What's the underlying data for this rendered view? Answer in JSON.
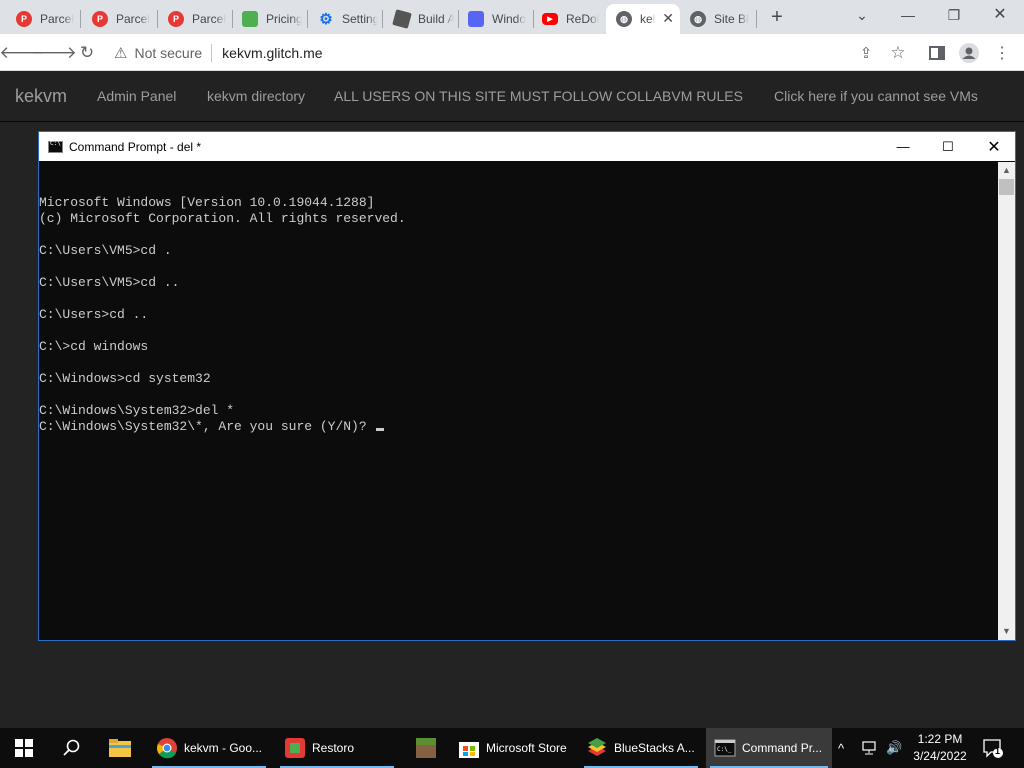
{
  "browser": {
    "tabs": [
      {
        "label": "Parcel",
        "favicon": "parcel-icon",
        "color": "#e53935"
      },
      {
        "label": "Parcel",
        "favicon": "parcel-icon",
        "color": "#e53935"
      },
      {
        "label": "Parcel",
        "favicon": "parcel-icon",
        "color": "#e53935"
      },
      {
        "label": "Pricing",
        "favicon": "pricing-icon",
        "color": "#4caf50"
      },
      {
        "label": "Settings",
        "favicon": "gear-icon",
        "color": "#1a73e8"
      },
      {
        "label": "Build A",
        "favicon": "roblox-icon",
        "color": "#555555"
      },
      {
        "label": "Windo",
        "favicon": "discord-icon",
        "color": "#5865f2"
      },
      {
        "label": "ReDol",
        "favicon": "youtube-icon",
        "color": "#ff0000"
      },
      {
        "label": "kel",
        "favicon": "globe-icon",
        "color": "#5f6368"
      },
      {
        "label": "Site Bl",
        "favicon": "globe-icon",
        "color": "#5f6368"
      }
    ],
    "address": {
      "security": "Not secure",
      "url": "kekvm.glitch.me"
    }
  },
  "site": {
    "brand": "kekvm",
    "links": [
      "Admin Panel",
      "kekvm directory",
      "ALL USERS ON THIS SITE MUST FOLLOW COLLABVM RULES",
      "Click here if you cannot see VMs"
    ]
  },
  "cmd": {
    "title": "Command Prompt - del  *",
    "lines": [
      "Microsoft Windows [Version 10.0.19044.1288]",
      "(c) Microsoft Corporation. All rights reserved.",
      "",
      "C:\\Users\\VM5>cd .",
      "",
      "C:\\Users\\VM5>cd ..",
      "",
      "C:\\Users>cd ..",
      "",
      "C:\\>cd windows",
      "",
      "C:\\Windows>cd system32",
      "",
      "C:\\Windows\\System32>del *"
    ],
    "prompt_line": "C:\\Windows\\System32\\*, Are you sure (Y/N)? "
  },
  "taskbar": {
    "items": [
      {
        "label": "kekvm - Goo...",
        "icon": "chrome-icon"
      },
      {
        "label": "Restoro",
        "icon": "restoro-icon"
      },
      {
        "label": "",
        "icon": "minecraft-icon"
      },
      {
        "label": "Microsoft Store",
        "icon": "store-icon"
      },
      {
        "label": "BlueStacks A...",
        "icon": "bluestacks-icon"
      },
      {
        "label": "Command Pr...",
        "icon": "cmd-icon"
      }
    ],
    "time": "1:22 PM",
    "date": "3/24/2022",
    "notification_count": "1"
  }
}
